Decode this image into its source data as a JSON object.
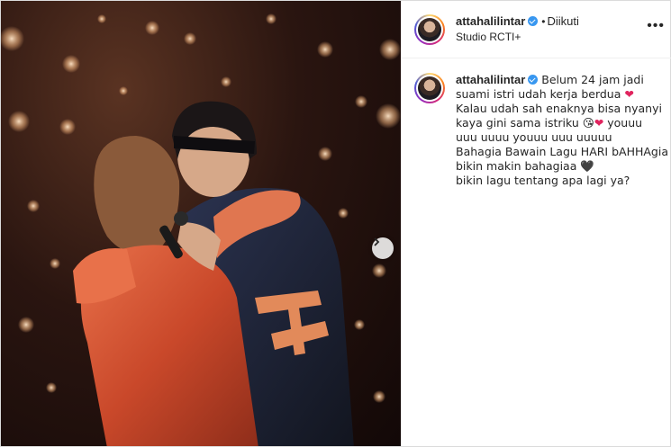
{
  "header": {
    "username": "attahalilintar",
    "dot": "•",
    "follow_label": "Diikuti",
    "location": "Studio RCTI+",
    "more_icon": "more-horizontal-icon"
  },
  "caption": {
    "username": "attahalilintar",
    "lines": [
      "Belum 24 jam jadi",
      "suami istri udah kerja berdua",
      "Kalau udah sah enaknya bisa nyanyi",
      "kaya gini sama istriku",
      "youuu",
      "uuu uuuu youuu uuu uuuuu",
      "Bahagia Bawain Lagu HARI bAHHAgia",
      "bikin makin bahagiaa",
      "bikin lagu tentang apa lagi ya?"
    ],
    "emoji": {
      "red_heart": "❤",
      "blush": "😘",
      "black_heart": "🖤"
    }
  },
  "media": {
    "next_icon": "chevron-right-icon"
  },
  "colors": {
    "verified": "#3897f0",
    "heart": "#e0245e",
    "dress": "#d2562f",
    "jacket": "#1c2236"
  }
}
